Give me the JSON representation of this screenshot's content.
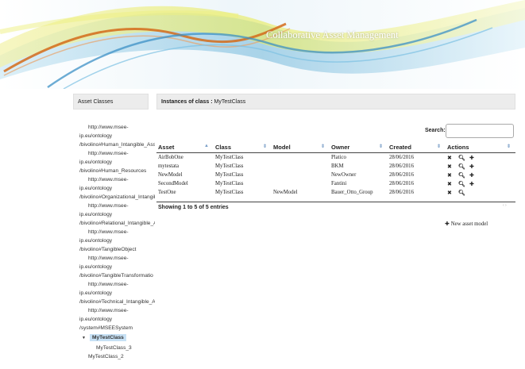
{
  "header": {
    "title": "Collaborative Asset Management"
  },
  "left_panel": {
    "title": "Asset Classes",
    "tree": [
      {
        "text": "http://www.msee-",
        "indent": true
      },
      {
        "text": "ip.eu/ontology",
        "indent": false
      },
      {
        "text": "/bivolino#Human_Intangible_Ass",
        "indent": false
      },
      {
        "text": "http://www.msee-",
        "indent": true
      },
      {
        "text": "ip.eu/ontology",
        "indent": false
      },
      {
        "text": "/bivolino#Human_Resources",
        "indent": false
      },
      {
        "text": "http://www.msee-",
        "indent": true
      },
      {
        "text": "ip.eu/ontology",
        "indent": false
      },
      {
        "text": "/bivolino#Organizational_Intangib",
        "indent": false
      },
      {
        "text": "http://www.msee-",
        "indent": true
      },
      {
        "text": "ip.eu/ontology",
        "indent": false
      },
      {
        "text": "/bivolino#Relational_Intangible_A",
        "indent": false
      },
      {
        "text": "http://www.msee-",
        "indent": true
      },
      {
        "text": "ip.eu/ontology",
        "indent": false
      },
      {
        "text": "/bivolino#TangibleObject",
        "indent": false
      },
      {
        "text": "http://www.msee-",
        "indent": true
      },
      {
        "text": "ip.eu/ontology",
        "indent": false
      },
      {
        "text": "/bivolino#TangibleTransformatio",
        "indent": false
      },
      {
        "text": "http://www.msee-",
        "indent": true
      },
      {
        "text": "ip.eu/ontology",
        "indent": false
      },
      {
        "text": "/bivolino#Technical_Intangible_A",
        "indent": false
      },
      {
        "text": "http://www.msee-",
        "indent": true
      },
      {
        "text": "ip.eu/ontology",
        "indent": false
      },
      {
        "text": "/system#MSEESystem",
        "indent": false
      }
    ],
    "selected": "MyTestClass",
    "child": "MyTestClass_3",
    "sibling": "MyTestClass_2"
  },
  "right_panel": {
    "title_prefix": "Instances of class :",
    "title_class": "MyTestClass",
    "search_label": "Search:",
    "search_value": "",
    "columns": [
      "Asset",
      "Class",
      "Model",
      "Owner",
      "Created",
      "Actions"
    ],
    "rows": [
      {
        "asset": "AirBobOne",
        "class": "MyTestClass",
        "model": "",
        "owner": "Platico",
        "created": "28/06/2016",
        "add": true
      },
      {
        "asset": "mytestata",
        "class": "MyTestClass",
        "model": "",
        "owner": "BKM",
        "created": "28/06/2016",
        "add": true
      },
      {
        "asset": "NewModel",
        "class": "MyTestClass",
        "model": "",
        "owner": "NewOwner",
        "created": "28/06/2016",
        "add": true
      },
      {
        "asset": "SecondModel",
        "class": "MyTestClass",
        "model": "",
        "owner": "Fantini",
        "created": "28/06/2016",
        "add": true
      },
      {
        "asset": "TestOne",
        "class": "MyTestClass",
        "model": "NewModel",
        "owner": "Bauer_Otto_Group",
        "created": "28/06/2016",
        "add": false
      }
    ],
    "info": "Showing 1 to 5 of 5 entries",
    "new_model": "New asset model"
  },
  "icons": {
    "delete": "close-icon",
    "view": "search-icon",
    "add": "plus-icon",
    "sort": "sort-arrows-icon"
  },
  "colors": {
    "selection": "#c7e1f5",
    "panel_header": "#ececec",
    "sort_arrow": "#7a9fc8"
  }
}
